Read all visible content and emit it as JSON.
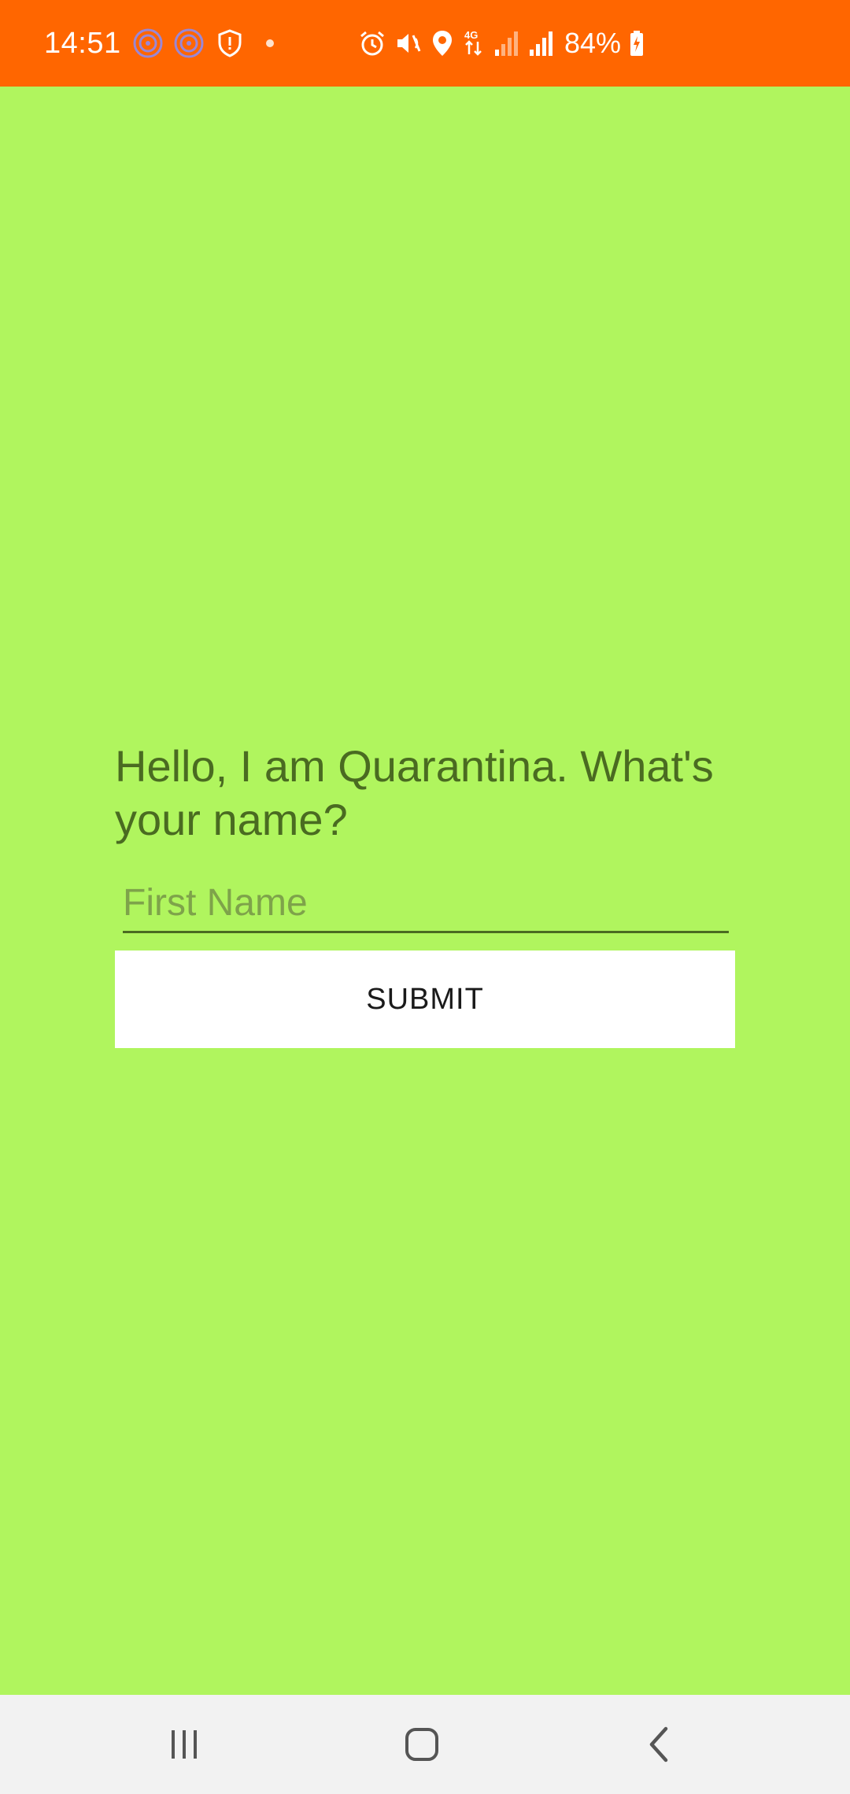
{
  "status_bar": {
    "time": "14:51",
    "battery_text": "84%",
    "notification_icons": [
      "wifi-calling-icon",
      "wifi-calling-icon",
      "shield-icon",
      "dot-icon"
    ],
    "system_icons": [
      "alarm-icon",
      "mute-icon",
      "location-icon",
      "4g-data-icon",
      "signal-icon",
      "signal-icon",
      "battery-charging-icon"
    ],
    "colors": {
      "background": "#ff6600",
      "foreground": "#ffffff"
    }
  },
  "main": {
    "prompt": "Hello, I am Quarantina. What's your name?",
    "name_input": {
      "value": "",
      "placeholder": "First Name"
    },
    "submit_label": "SUBMIT",
    "colors": {
      "background": "#b0f55e",
      "text": "#4a6b21",
      "button": "#ffffff"
    }
  },
  "nav_bar": {
    "buttons": [
      "recents-icon",
      "home-icon",
      "back-icon"
    ]
  }
}
